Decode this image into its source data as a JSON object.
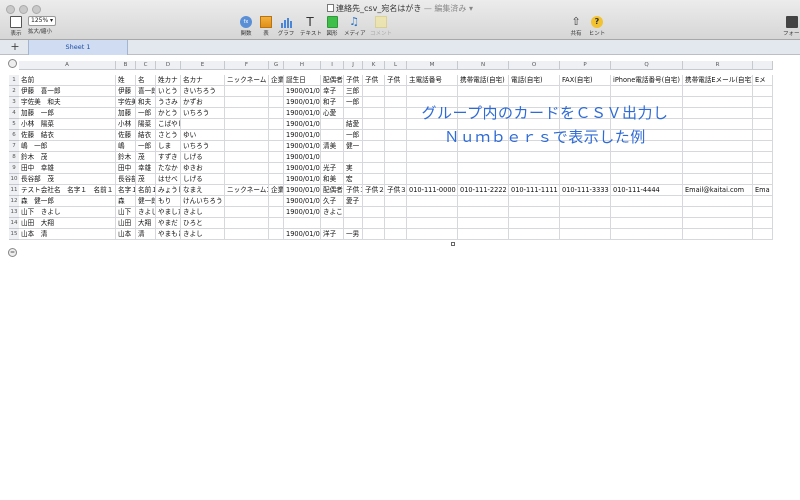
{
  "window": {
    "title": "連絡先_csv_宛名はがき",
    "status": "— 編集済み ▾"
  },
  "toolbar": {
    "view_label": "表示",
    "zoom_value": "125% ▾",
    "zoom_label": "拡大/縮小",
    "function_label": "関数",
    "table_label": "表",
    "chart_label": "グラフ",
    "text_label": "テキスト",
    "shape_label": "図形",
    "media_label": "メディア",
    "comment_label": "コメント",
    "share_label": "共有",
    "tips_label": "ヒント",
    "format_label": "フォーマ"
  },
  "sheetbar": {
    "add_label": "+",
    "tab_label": "Sheet 1"
  },
  "columns": [
    "A",
    "B",
    "C",
    "D",
    "E",
    "F",
    "G",
    "H",
    "I",
    "J",
    "K",
    "L",
    "M",
    "N",
    "O",
    "P",
    "Q",
    "R"
  ],
  "row_numbers": [
    "1",
    "2",
    "3",
    "4",
    "5",
    "6",
    "7",
    "8",
    "9",
    "10",
    "11",
    "12",
    "13",
    "14",
    "15"
  ],
  "rows": [
    [
      "名前",
      "姓",
      "名",
      "姓カナ",
      "名カナ",
      "ニックネーム",
      "企業",
      "誕生日",
      "配偶者",
      "子供",
      "子供",
      "子供",
      "主電話番号",
      "携帯電話(自宅)",
      "電話(自宅)",
      "FAX(自宅)",
      "iPhone電話番号(自宅)",
      "携帯電話Eメール(自宅)",
      "Eメ"
    ],
    [
      "伊藤　喜一郎",
      "伊藤",
      "喜一郎",
      "いとう",
      "きいちろう",
      "",
      "",
      "1900/01/01",
      "幸子",
      "三郎",
      "",
      "",
      "",
      "",
      "",
      "",
      "",
      "",
      ""
    ],
    [
      "宇佐美　和夫",
      "宇佐美",
      "和夫",
      "うさみ",
      "かずお",
      "",
      "",
      "1900/01/01",
      "和子",
      "一郎",
      "",
      "",
      "",
      "",
      "",
      "",
      "",
      "",
      ""
    ],
    [
      "加藤　一郎",
      "加藤",
      "一郎",
      "かとう",
      "いちろう",
      "",
      "",
      "1900/01/01",
      "心愛",
      "",
      "",
      "",
      "",
      "",
      "",
      "",
      "",
      "",
      ""
    ],
    [
      "小林　陽菜",
      "小林",
      "陽菜",
      "こばやし",
      "",
      "",
      "",
      "1900/01/01",
      "",
      "結愛",
      "",
      "",
      "",
      "",
      "",
      "",
      "",
      "",
      ""
    ],
    [
      "佐藤　結衣",
      "佐藤",
      "結衣",
      "さとう",
      "ゆい",
      "",
      "",
      "1900/01/01",
      "",
      "一郎",
      "",
      "",
      "",
      "",
      "",
      "",
      "",
      "",
      ""
    ],
    [
      "嶋　一郎",
      "嶋",
      "一郎",
      "しま",
      "いちろう",
      "",
      "",
      "1900/01/01",
      "清美",
      "健一",
      "",
      "",
      "",
      "",
      "",
      "",
      "",
      "",
      ""
    ],
    [
      "鈴木　茂",
      "鈴木",
      "茂",
      "すずき",
      "しげる",
      "",
      "",
      "1900/01/01",
      "",
      "",
      "",
      "",
      "",
      "",
      "",
      "",
      "",
      "",
      ""
    ],
    [
      "田中　幸雄",
      "田中",
      "幸雄",
      "たなか",
      "ゆきお",
      "",
      "",
      "1900/01/01",
      "光子",
      "実",
      "",
      "",
      "",
      "",
      "",
      "",
      "",
      "",
      ""
    ],
    [
      "長谷部　茂",
      "長谷部",
      "茂",
      "はせべ",
      "しげる",
      "",
      "",
      "1900/01/01",
      "和美",
      "宏",
      "",
      "",
      "",
      "",
      "",
      "",
      "",
      "",
      ""
    ],
    [
      "テスト会社名　名字１　名前１",
      "名字１",
      "名前１",
      "みょうじ",
      "なまえ",
      "ニックネーム1",
      "企業",
      "1900/01/01",
      "配偶者",
      "子供１",
      "子供２",
      "子供３",
      "010-111-0000",
      "010-111-2222",
      "010-111-1111",
      "010-111-3333",
      "010-111-4444",
      "Email@kaitai.com",
      "Ema"
    ],
    [
      "森　健一郎",
      "森",
      "健一郎",
      "もり",
      "けんいちろう",
      "",
      "",
      "1900/01/01",
      "久子",
      "愛子",
      "",
      "",
      "",
      "",
      "",
      "",
      "",
      "",
      ""
    ],
    [
      "山下　きよし",
      "山下",
      "きよし",
      "やました",
      "きよし",
      "",
      "",
      "1900/01/01",
      "きよこ",
      "",
      "",
      "",
      "",
      "",
      "",
      "",
      "",
      "",
      ""
    ],
    [
      "山田　大翔",
      "山田",
      "大翔",
      "やまだ",
      "ひろと",
      "",
      "",
      "",
      "",
      "",
      "",
      "",
      "",
      "",
      "",
      "",
      "",
      "",
      ""
    ],
    [
      "山本　清",
      "山本",
      "清",
      "やまもと",
      "きよし",
      "",
      "",
      "1900/01/01",
      "洋子",
      "一男",
      "",
      "",
      "",
      "",
      "",
      "",
      "",
      "",
      ""
    ]
  ],
  "annotation": {
    "line1": "グループ内のカードをＣＳＶ出力し",
    "line2": "Ｎｕｍｂｅｒｓで表示した例"
  }
}
